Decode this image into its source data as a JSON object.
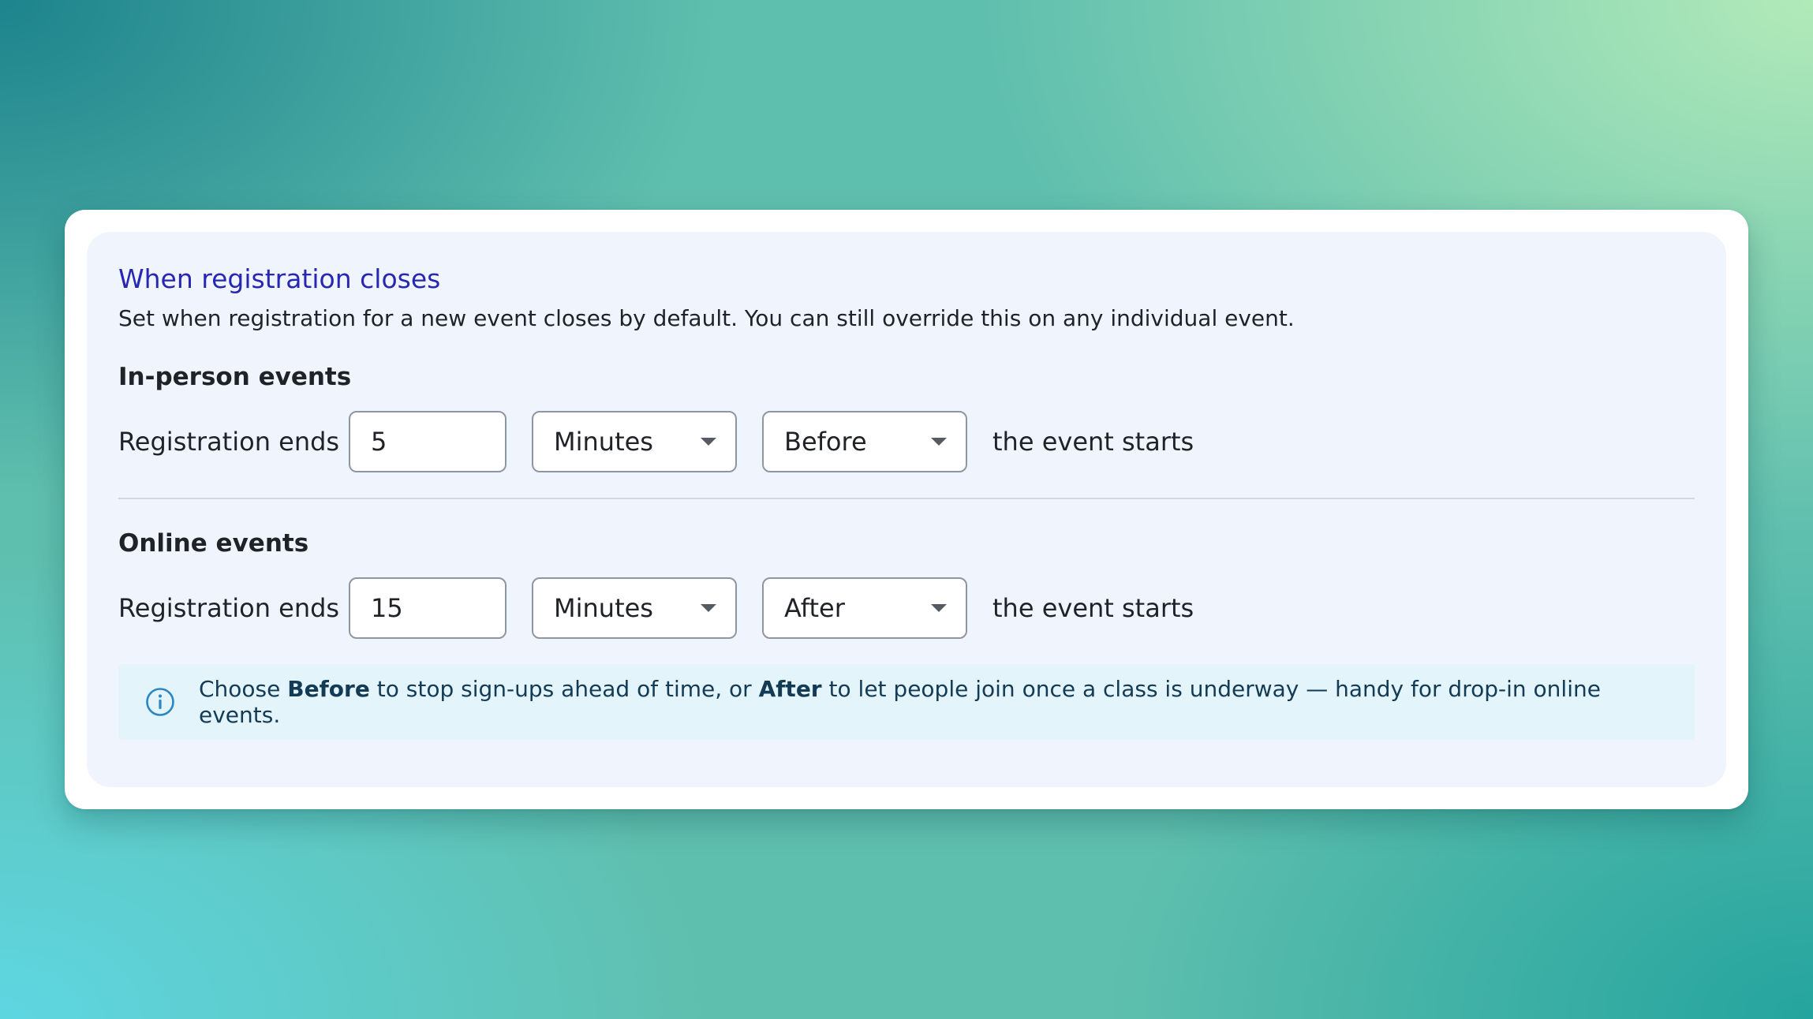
{
  "settings": {
    "title": "When registration closes",
    "description": "Set when registration for a new event closes by default. You can still override this on any individual event."
  },
  "in_person": {
    "heading": "In-person events",
    "label": "Registration ends",
    "amount": "5",
    "unit": "Minutes",
    "timing": "Before",
    "suffix": "the event starts"
  },
  "online": {
    "heading": "Online events",
    "label": "Registration ends",
    "amount": "15",
    "unit": "Minutes",
    "timing": "After",
    "suffix": "the event starts"
  },
  "info": {
    "icon": "info-icon",
    "text_1": "Choose ",
    "bold_1": "Before",
    "text_2": " to stop sign-ups ahead of time, or ",
    "bold_2": "After",
    "text_3": " to let people join once a class is underway — handy for drop-in online events."
  },
  "colors": {
    "title": "#2727b4",
    "panel": "#f0f5fd",
    "info_bg": "#e3f4fa",
    "info_text": "#143b55",
    "info_icon": "#2a86c5"
  }
}
